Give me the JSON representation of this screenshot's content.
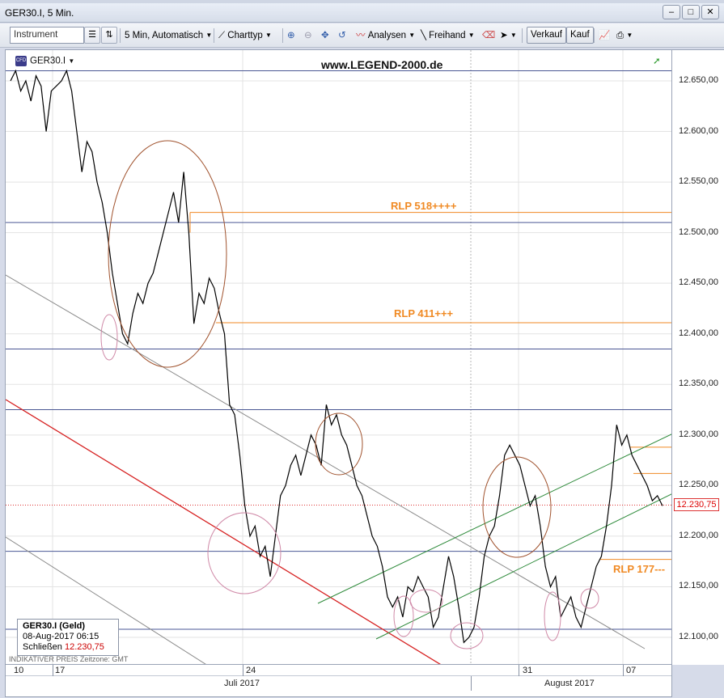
{
  "window": {
    "title": "GER30.I, 5 Min."
  },
  "toolbar": {
    "instrument_placeholder": "Instrument",
    "interval": "5 Min,",
    "mode": "Automatisch",
    "chart_type": "Charttyp",
    "analyses": "Analysen",
    "freehand": "Freihand",
    "sell": "Verkauf",
    "buy": "Kauf"
  },
  "chart": {
    "symbol": "GER30.I",
    "watermark": "www.LEGEND-2000.de",
    "rlp_518": "RLP 518++++",
    "rlp_411": "RLP 411+++",
    "rlp_177": "RLP 177---",
    "current_price": "12.230,75",
    "y_ticks": [
      "12.650,00",
      "12.600,00",
      "12.550,00",
      "12.500,00",
      "12.450,00",
      "12.400,00",
      "12.350,00",
      "12.300,00",
      "12.250,00",
      "12.200,00",
      "12.150,00",
      "12.100,00"
    ],
    "x_ticks": [
      "10",
      "17",
      "24",
      "31",
      "07"
    ],
    "months": [
      "Juli 2017",
      "August 2017"
    ],
    "colors": {
      "price": "#000000",
      "resistance": "#f08a24",
      "support_lines": "#4a5794",
      "trend_red": "#d62020",
      "trend_gray": "#8a8a8a",
      "channel": "#2d8a3a",
      "circle_brown": "#a0522d",
      "circle_pink": "#d08aa8"
    }
  },
  "chart_data": {
    "type": "line",
    "ylim": [
      12085,
      12680
    ],
    "series": [
      {
        "values": [
          12650,
          12660,
          12640,
          12650,
          12630,
          12655,
          12645,
          12600,
          12640,
          12645,
          12650,
          12660,
          12640,
          12600,
          12560,
          12590,
          12580,
          12550,
          12530,
          12500,
          12460,
          12430,
          12400,
          12390,
          12420,
          12440,
          12430,
          12450,
          12460,
          12480,
          12500,
          12520,
          12540,
          12510,
          12560,
          12500,
          12410,
          12440,
          12430,
          12455,
          12445,
          12420,
          12400,
          12330,
          12320,
          12280,
          12230,
          12200,
          12210,
          12180,
          12190,
          12160,
          12200,
          12240,
          12250,
          12270,
          12280,
          12260,
          12280,
          12300,
          12290,
          12270,
          12330,
          12310,
          12320,
          12300,
          12290,
          12270,
          12250,
          12240,
          12220,
          12200,
          12190,
          12170,
          12140,
          12130,
          12140,
          12120,
          12150,
          12145,
          12160,
          12150,
          12140,
          12110,
          12120,
          12150,
          12180,
          12160,
          12130,
          12095,
          12100,
          12110,
          12140,
          12180,
          12200,
          12210,
          12240,
          12280,
          12290,
          12280,
          12270,
          12250,
          12230,
          12240,
          12210,
          12170,
          12150,
          12160,
          12120,
          12130,
          12140,
          12120,
          12110,
          12130,
          12150,
          12170,
          12180,
          12210,
          12250,
          12310,
          12290,
          12300,
          12280,
          12270,
          12260,
          12250,
          12235,
          12240,
          12230
        ]
      }
    ],
    "annotations": [
      "RLP 518++++",
      "RLP 411+++",
      "RLP 177---"
    ],
    "current_value": 12230.75
  },
  "info": {
    "title": "GER30.I (Geld)",
    "date": "08-Aug-2017 06:15",
    "close_label": "Schließen",
    "close_value": "12.230,75",
    "footer": "INDIKATIVER PREIS   Zeitzone: GMT"
  }
}
